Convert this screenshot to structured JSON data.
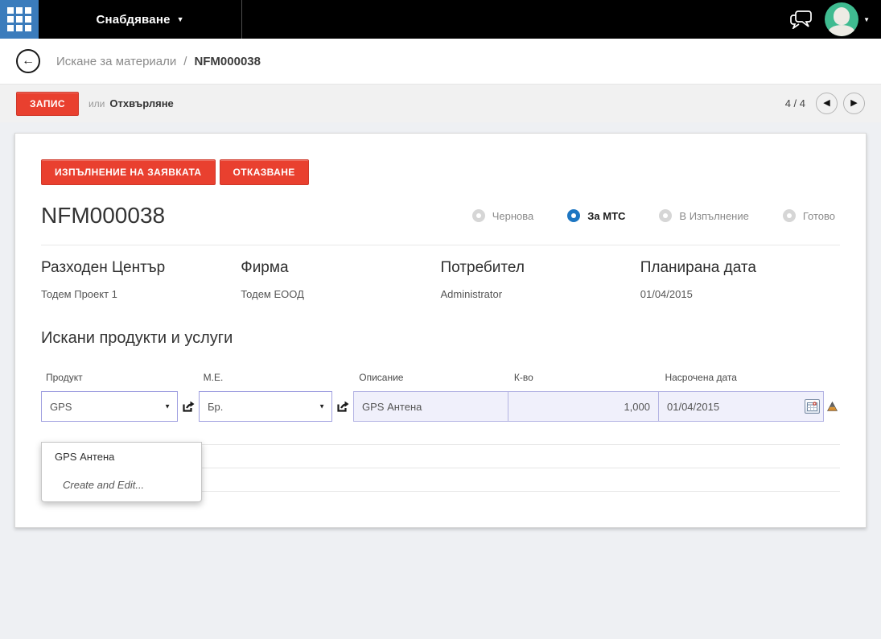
{
  "topbar": {
    "menu_label": "Снабдяване"
  },
  "breadcrumb": {
    "parent": "Искане за материали",
    "separator": "/",
    "current": "NFM000038"
  },
  "toolbar": {
    "save_label": "ЗАПИС",
    "or_label": "или",
    "discard_label": "Отхвърляне",
    "pager_count": "4 / 4"
  },
  "actions": {
    "execute_label": "ИЗПЪЛНЕНИЕ НА ЗАЯВКАТА",
    "cancel_label": "ОТКАЗВАНЕ"
  },
  "record": {
    "title": "NFM000038",
    "statuses": [
      {
        "label": "Чернова",
        "selected": false
      },
      {
        "label": "За МТС",
        "selected": true
      },
      {
        "label": "В Изпълнение",
        "selected": false
      },
      {
        "label": "Готово",
        "selected": false
      }
    ],
    "fields": [
      {
        "label": "Разходен Център",
        "value": "Тодем Проект 1"
      },
      {
        "label": "Фирма",
        "value": "Тодем ЕООД"
      },
      {
        "label": "Потребител",
        "value": "Administrator"
      },
      {
        "label": "Планирана дата",
        "value": "01/04/2015"
      }
    ]
  },
  "lines": {
    "section_title": "Искани продукти и услуги",
    "columns": [
      "Продукт",
      "М.Е.",
      "Описание",
      "К-во",
      "Насрочена дата"
    ],
    "row": {
      "product": "GPS",
      "uom": "Бр.",
      "description": "GPS Антена",
      "qty": "1,000",
      "date": "01/04/2015"
    },
    "dropdown": {
      "options": [
        "GPS Антена"
      ],
      "create_label": "Create and Edit..."
    }
  },
  "icons": {
    "menu_caret": "▼",
    "avatar_caret": "▼",
    "back_arrow": "←",
    "pager_prev": "◀",
    "pager_next": "▶",
    "select_caret": "▼"
  },
  "colors": {
    "brand_blue": "#3b7cbc",
    "accent_red": "#e9402f",
    "status_selected_blue": "#1d76c2",
    "avatar_green": "#3fbb90",
    "field_border_lavender": "#b3b3e3"
  }
}
